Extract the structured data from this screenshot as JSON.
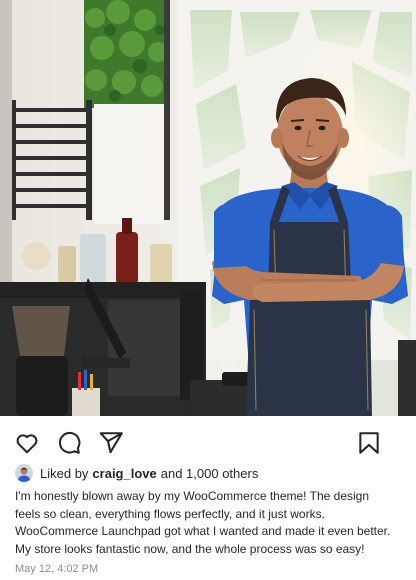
{
  "post": {
    "photo_icon": "man-arms-crossed-photo",
    "likes": {
      "prefix": "Liked by",
      "user": "craig_love",
      "suffix": "and 1,000 others"
    },
    "caption_lines": [
      "I'm honestly blown away by my WooCommerce theme! The design",
      "feels so clean, everything flows perfectly, and it just works.",
      "WooCommerce Launchpad got what I wanted and made it even better.",
      "My store looks fantastic now, and the whole process was so easy!"
    ],
    "timestamp": "May 12, 4:02 PM"
  },
  "actions": {
    "like_icon": "heart-icon",
    "comment_icon": "comment-icon",
    "share_icon": "send-icon",
    "save_icon": "bookmark-icon"
  },
  "colors": {
    "text": "#262626",
    "muted": "#8e8e8e",
    "shirt": "#2a63c9",
    "apron": "#2b3447"
  }
}
